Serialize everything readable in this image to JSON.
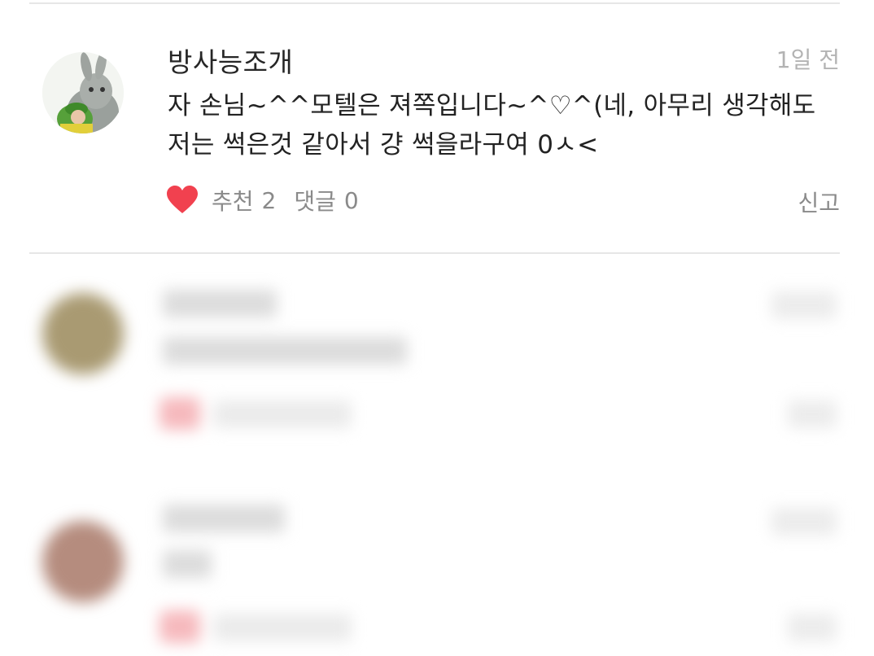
{
  "comment": {
    "author": "방사능조개",
    "time": "1일 전",
    "text_lines": [
      "자 손님~^^모텔은 져쪽입니다~^♡^(네, 아무리 생각해도",
      "저는 썩은것 같아서 걍 썩을라구여 0ㅅ<"
    ],
    "like_label": "추천",
    "like_count": "2",
    "reply_label": "댓글",
    "reply_count": "0",
    "report_label": "신고",
    "avatar_icon": "bunny-costume-avatar",
    "like_icon": "heart-icon",
    "like_color": "#f1414f"
  },
  "blurred_comments": [
    {
      "avatar_color": "#a99a72"
    },
    {
      "avatar_color": "#b58c7e"
    }
  ]
}
